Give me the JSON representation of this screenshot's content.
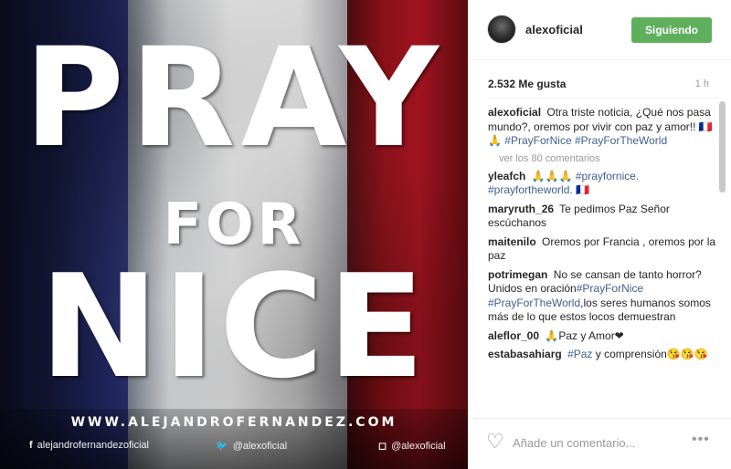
{
  "poster": {
    "line1": "PRAY",
    "line2": "FOR",
    "line3": "NICE",
    "url": "WWW.ALEJANDROFERNANDEZ.COM",
    "social": [
      {
        "icon": "f",
        "text": "alejandrofernandezoficial"
      },
      {
        "icon": "🐦",
        "text": "@alexoficial"
      },
      {
        "icon": "◻",
        "text": "@alexoficial"
      }
    ]
  },
  "header": {
    "username": "alexoficial",
    "follow_label": "Siguiendo"
  },
  "stats": {
    "likes": "2.532 Me gusta",
    "time": "1 h"
  },
  "caption": {
    "user": "alexoficial",
    "text": "Otra triste noticia, ¿Qué nos pasa mundo?, oremos por vivir con paz y amor!! 🇫🇷🙏",
    "tags": "#PrayForNice #PrayForTheWorld"
  },
  "view_more": "ver los 80 comentarios",
  "comments": [
    {
      "user": "yleafch",
      "pre": "🙏🙏🙏",
      "tags": "#prayfornice. #prayfortheworld.",
      "post": " 🇫🇷"
    },
    {
      "user": "maryruth_26",
      "pre": "Te pedimos Paz Señor escúchanos",
      "tags": "",
      "post": ""
    },
    {
      "user": "maitenilo",
      "pre": "Oremos por Francia , oremos por la paz",
      "tags": "",
      "post": ""
    },
    {
      "user": "potrimegan",
      "pre": "No se cansan de tanto horror?Unidos en oración",
      "tags": "#PrayForNice #PrayForTheWorld",
      "post": ",los seres humanos somos más de lo que estos locos demuestran"
    },
    {
      "user": "aleflor_00",
      "pre": "🙏Paz y Amor❤",
      "tags": "",
      "post": ""
    },
    {
      "user": "estabasahiarg",
      "pre": "",
      "tags": "#Paz",
      "post": " y comprensión😘😘😘"
    }
  ],
  "footer": {
    "placeholder": "Añade un comentario...",
    "more": "•••"
  },
  "icons": {
    "heart": "heart-icon",
    "more": "more-options-icon"
  },
  "colors": {
    "follow_button": "#5fb05c",
    "hashtag": "#3f5f8f"
  }
}
